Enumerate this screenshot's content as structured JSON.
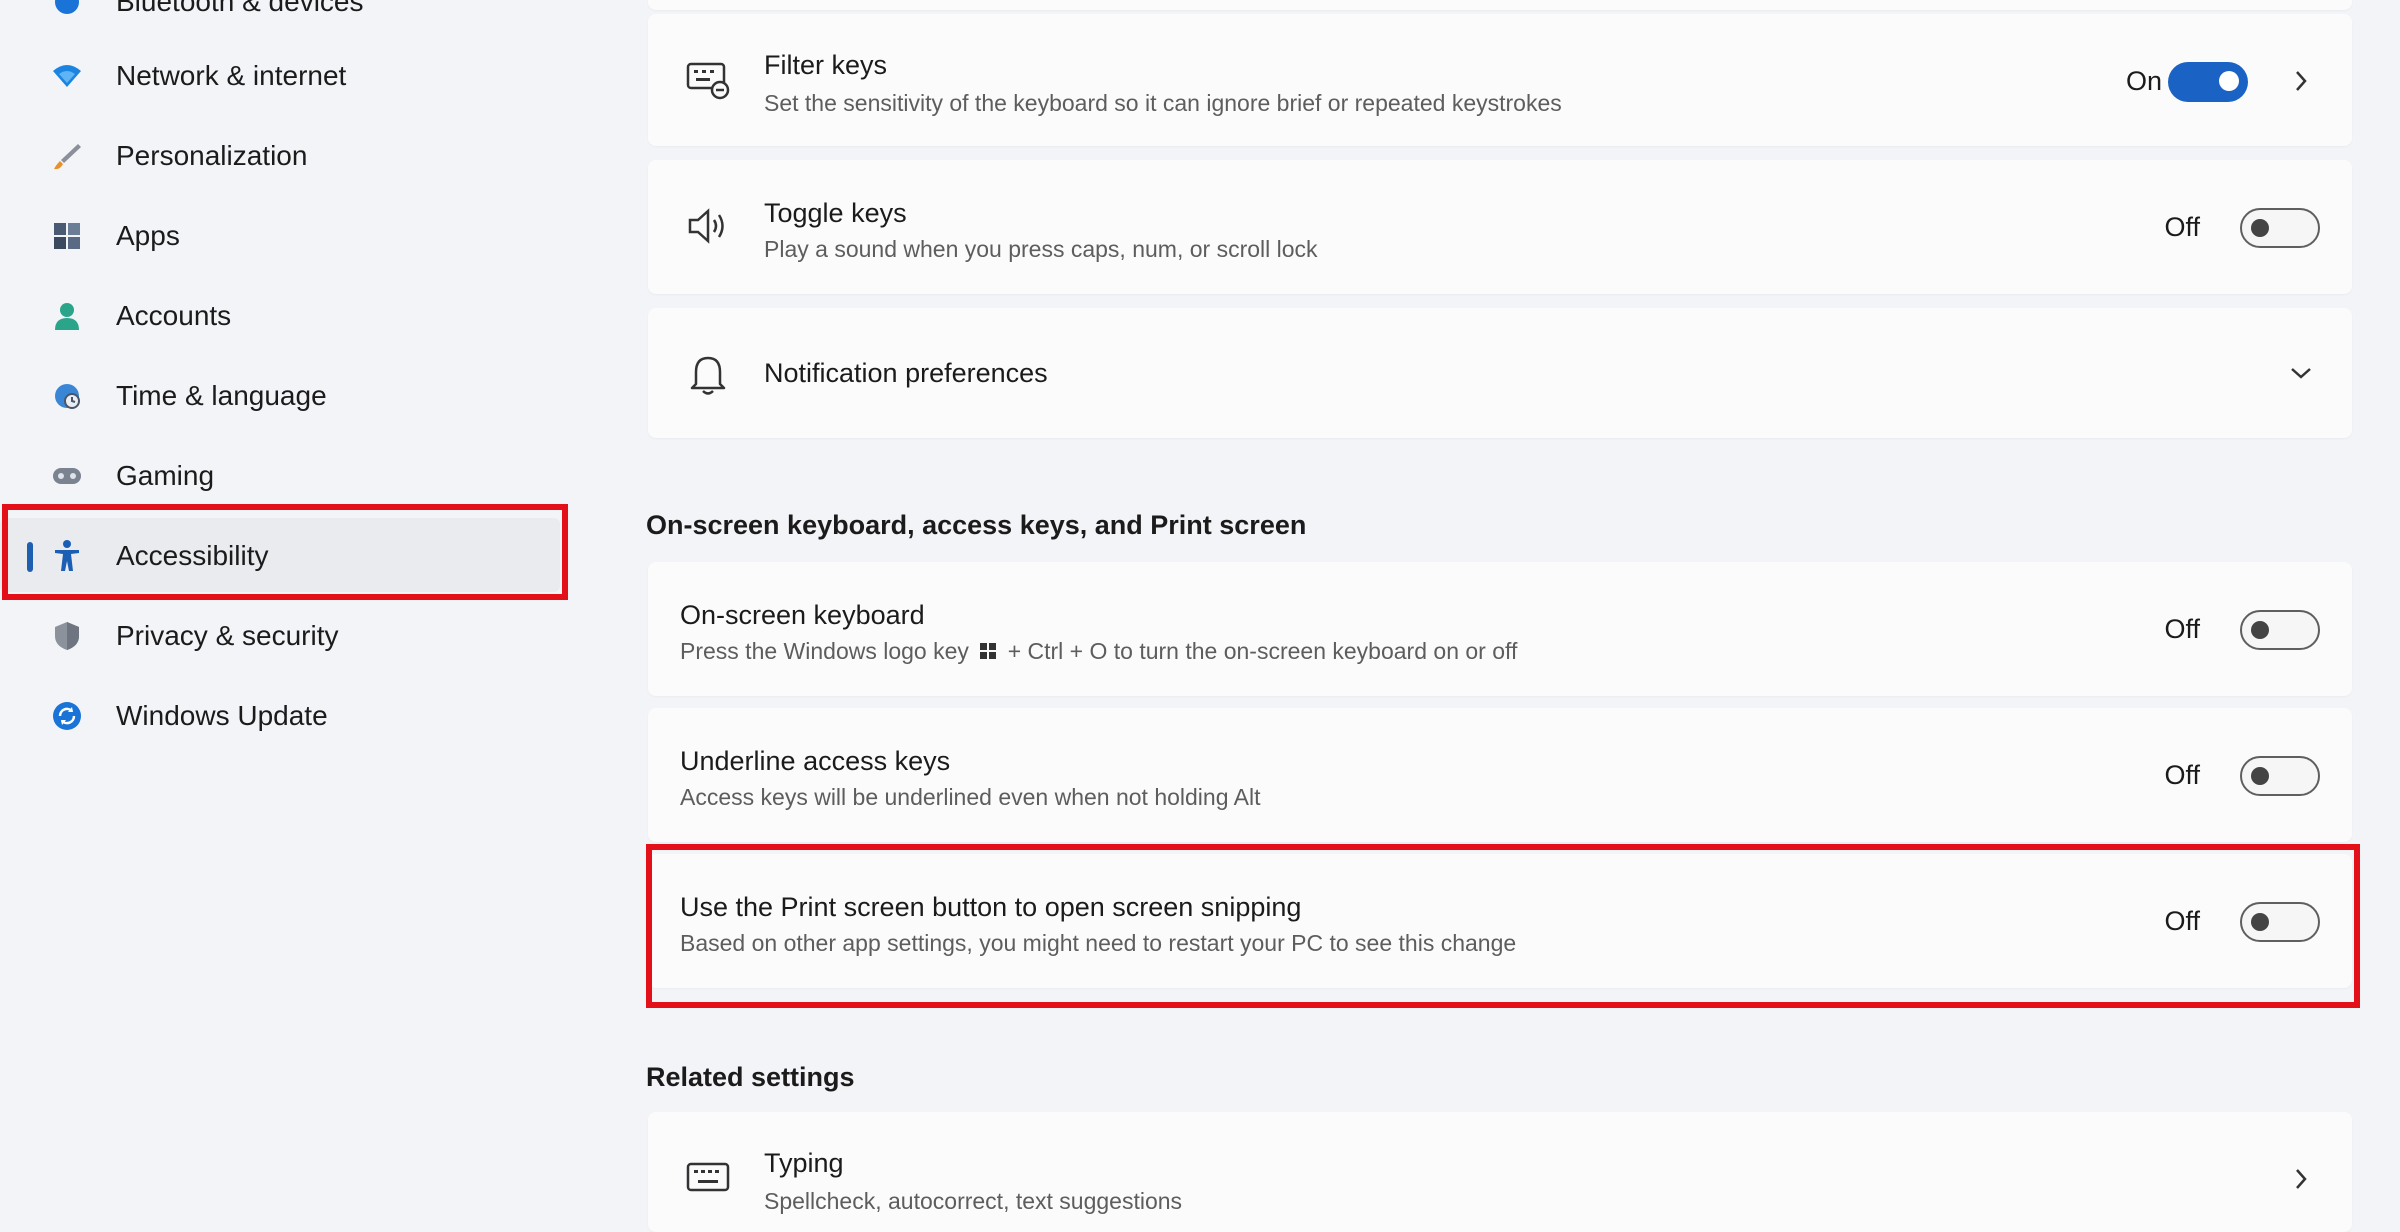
{
  "sidebar": {
    "items": [
      {
        "label": "Bluetooth & devices",
        "icon": "bluetooth-icon"
      },
      {
        "label": "Network & internet",
        "icon": "wifi-icon"
      },
      {
        "label": "Personalization",
        "icon": "brush-icon"
      },
      {
        "label": "Apps",
        "icon": "apps-icon"
      },
      {
        "label": "Accounts",
        "icon": "person-icon"
      },
      {
        "label": "Time & language",
        "icon": "globe-clock-icon"
      },
      {
        "label": "Gaming",
        "icon": "gamepad-icon"
      },
      {
        "label": "Accessibility",
        "icon": "accessibility-icon"
      },
      {
        "label": "Privacy & security",
        "icon": "shield-icon"
      },
      {
        "label": "Windows Update",
        "icon": "update-icon"
      }
    ],
    "selected": "Accessibility"
  },
  "keyboard_settings": [
    {
      "title": "Filter keys",
      "desc": "Set the sensitivity of the keyboard so it can ignore brief or repeated keystrokes",
      "state": "On",
      "icon": "filter-keys-icon"
    },
    {
      "title": "Toggle keys",
      "desc": "Play a sound when you press caps, num, or scroll lock",
      "state": "Off",
      "icon": "speaker-icon"
    },
    {
      "title": "Notification preferences",
      "icon": "bell-icon"
    }
  ],
  "section_osk": {
    "heading": "On-screen keyboard, access keys, and Print screen",
    "items": [
      {
        "title": "On-screen keyboard",
        "desc_before": "Press the Windows logo key",
        "desc_after": "+ Ctrl + O to turn the on-screen keyboard on or off",
        "state": "Off"
      },
      {
        "title": "Underline access keys",
        "desc": "Access keys will be underlined even when not holding Alt",
        "state": "Off"
      },
      {
        "title": "Use the Print screen button to open screen snipping",
        "desc": "Based on other app settings, you might need to restart your PC to see this change",
        "state": "Off"
      }
    ]
  },
  "related": {
    "heading": "Related settings",
    "items": [
      {
        "title": "Typing",
        "desc": "Spellcheck, autocorrect, text suggestions",
        "icon": "keyboard-icon"
      }
    ]
  },
  "colors": {
    "accent": "#1a63c4",
    "highlight": "#e3101a",
    "selection_bar": "#1f5fb0"
  }
}
